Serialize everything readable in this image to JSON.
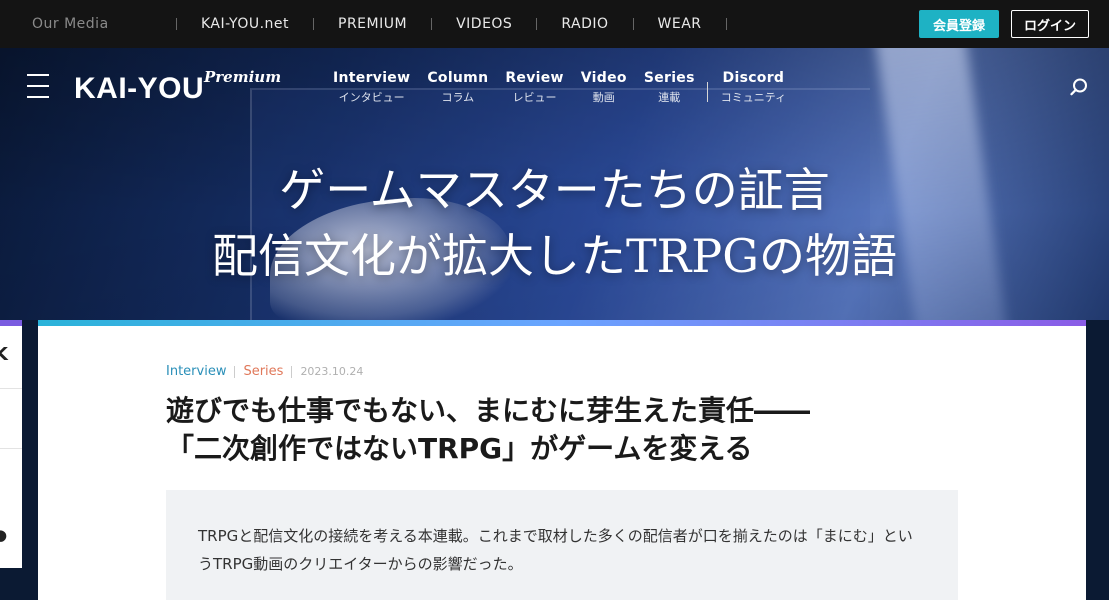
{
  "topbar": {
    "media_label": "Our Media",
    "links": [
      "KAI-YOU.net",
      "PREMIUM",
      "VIDEOS",
      "RADIO",
      "WEAR"
    ],
    "register_label": "会員登録",
    "login_label": "ログイン",
    "register_color": "#1eb2c4"
  },
  "header": {
    "logo": "KAI-YOU",
    "logo_sub": "Premium",
    "nav": [
      {
        "en": "Interview",
        "jp": "インタビュー"
      },
      {
        "en": "Column",
        "jp": "コラム"
      },
      {
        "en": "Review",
        "jp": "レビュー"
      },
      {
        "en": "Video",
        "jp": "動画"
      },
      {
        "en": "Series",
        "jp": "連載"
      },
      {
        "en": "Discord",
        "jp": "コミュニティ"
      }
    ],
    "icons": {
      "menu": "hamburger-icon",
      "search": "search-icon"
    }
  },
  "hero": {
    "title_line1": "ゲームマスターたちの証言",
    "title_line2": "配信文化が拡大したTRPGの物語"
  },
  "sidecard": {
    "glyphs": [
      "K",
      "!",
      "●"
    ]
  },
  "article": {
    "category1": "Interview",
    "category2": "Series",
    "date": "2023.10.24",
    "title_line1": "遊びでも仕事でもない、まにむに芽生えた責任――",
    "title_line2": "「二次創作ではないTRPG」がゲームを変える",
    "lead": "TRPGと配信文化の接続を考える本連載。これまで取材した多くの配信者が口を揃えたのは「まにむ」というTRPG動画のクリエイターからの影響だった。",
    "accent_gradient": [
      "#2ab3d9",
      "#8a5ce6"
    ]
  }
}
